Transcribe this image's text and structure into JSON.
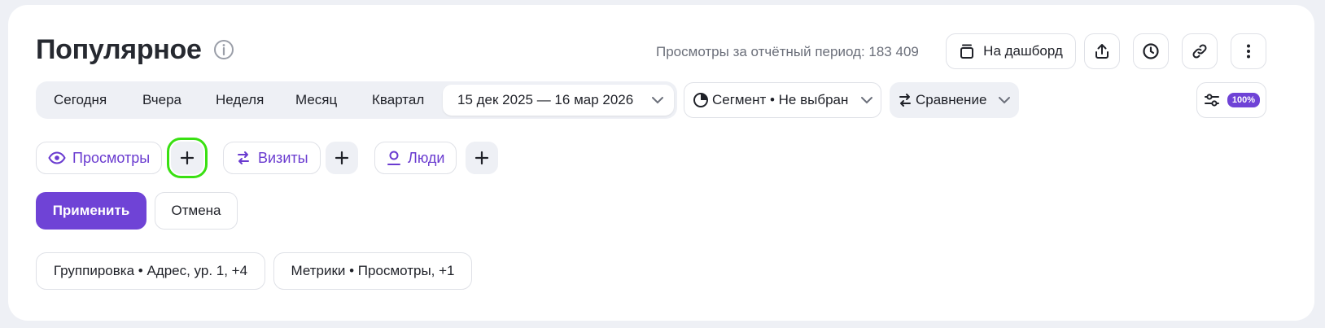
{
  "header": {
    "title": "Популярное",
    "views_label": "Просмотры за отчётный период: 183 409",
    "dashboard_label": "На дашборд"
  },
  "period": {
    "items": [
      "Сегодня",
      "Вчера",
      "Неделя",
      "Месяц",
      "Квартал"
    ],
    "date_range": "15 дек 2025 — 16 мар 2026"
  },
  "segment": {
    "label": "Сегмент • Не выбран"
  },
  "compare": {
    "label": "Сравнение"
  },
  "filters": {
    "badge": "100%"
  },
  "metrics": {
    "chips": [
      "Просмотры",
      "Визиты",
      "Люди"
    ]
  },
  "actions": {
    "apply": "Применить",
    "cancel": "Отмена"
  },
  "summary": {
    "grouping": "Группировка • Адрес, ур. 1, +4",
    "metrics": "Метрики • Просмотры, +1"
  },
  "colors": {
    "accent": "#6f43d6",
    "chip_text": "#6a3bd0",
    "highlight": "#39e012"
  },
  "icons": [
    "info-icon",
    "copy-icon",
    "share-icon",
    "clock-icon",
    "link-icon",
    "more-icon",
    "pie-icon",
    "compare-icon",
    "sliders-icon",
    "eye-icon",
    "person-icon",
    "plus-icon",
    "chevron-down-icon"
  ]
}
